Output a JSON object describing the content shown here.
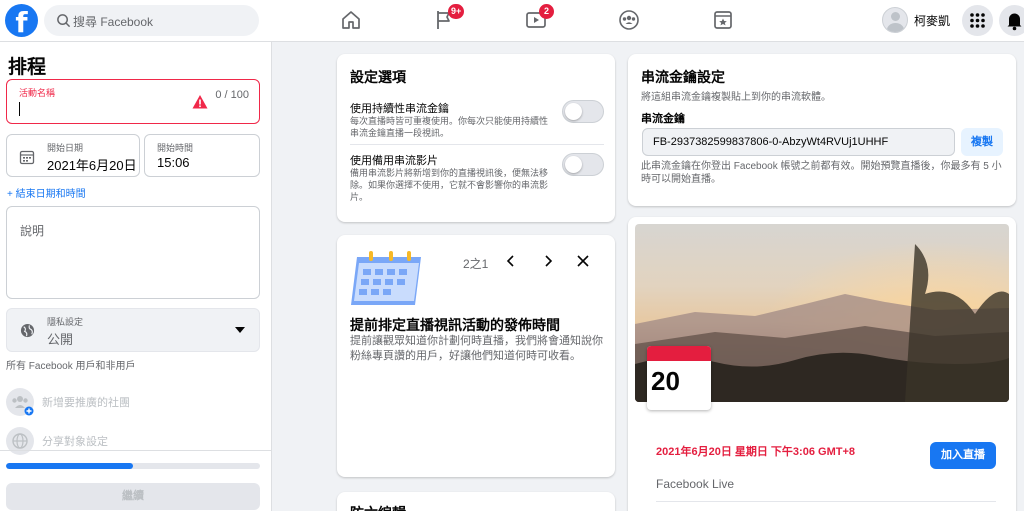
{
  "app": {
    "logo": "f",
    "search_placeholder": "搜尋 Facebook"
  },
  "nav": {
    "pages_badge": "9+",
    "watch_badge": "2"
  },
  "profile": {
    "name": "柯麥凱"
  },
  "left": {
    "title": "排程",
    "event_name": {
      "label": "活動名稱",
      "counter": "0 / 100"
    },
    "start_date": {
      "label": "開始日期",
      "value": "2021年6月20日"
    },
    "start_time": {
      "label": "開始時間",
      "value": "15:06"
    },
    "add_end_link": "+ 結束日期和時間",
    "description_placeholder": "說明",
    "privacy": {
      "label": "隱私設定",
      "value": "公開",
      "hint": "所有 Facebook 用戶和非用戶"
    },
    "add_community": "新增要推廣的社團",
    "share_settings": "分享對象設定",
    "progress_percent": 50,
    "continue": "繼續"
  },
  "settings_card": {
    "title": "設定選項",
    "options": [
      {
        "title": "使用持續性串流金鑰",
        "desc": "每次直播時皆可重複使用。你每次只能使用持續性串流金鑰直播一段視訊。"
      },
      {
        "title": "使用備用串流影片",
        "desc": "備用串流影片將新增到你的直播視訊後，便無法移除。如果你選擇不使用，它就不會影響你的串流影片。"
      }
    ]
  },
  "tip_card": {
    "pager": "2之1",
    "title": "提前排定直播視訊活動的發佈時間",
    "desc": "提前讓觀眾知道你計劃何時直播，我們將會通知說你粉絲專頁讚的用戶，好讓他們知道何時可收看。"
  },
  "bottom_card": {
    "title": "防六編輯"
  },
  "stream_key_card": {
    "title": "串流金鑰設定",
    "subtitle": "將這組串流金鑰複製貼上到你的串流軟體。",
    "key_label": "串流金鑰",
    "key_value": "FB-2937382599837806-0-AbzyWt4RVUj1UHHF",
    "copy": "複製",
    "note": "此串流金鑰在你登出 Facebook 帳號之前都有效。開始預覽直播後，你最多有 5 小時可以開始直播。"
  },
  "preview_card": {
    "calendar_day": "20",
    "datetime": "2021年6月20日 星期日 下午3:06 GMT+8",
    "source": "Facebook Live",
    "go_live": "加入直播"
  },
  "colors": {
    "brand": "#1877f2",
    "alert": "#f02849",
    "badge": "#e41e3f"
  }
}
